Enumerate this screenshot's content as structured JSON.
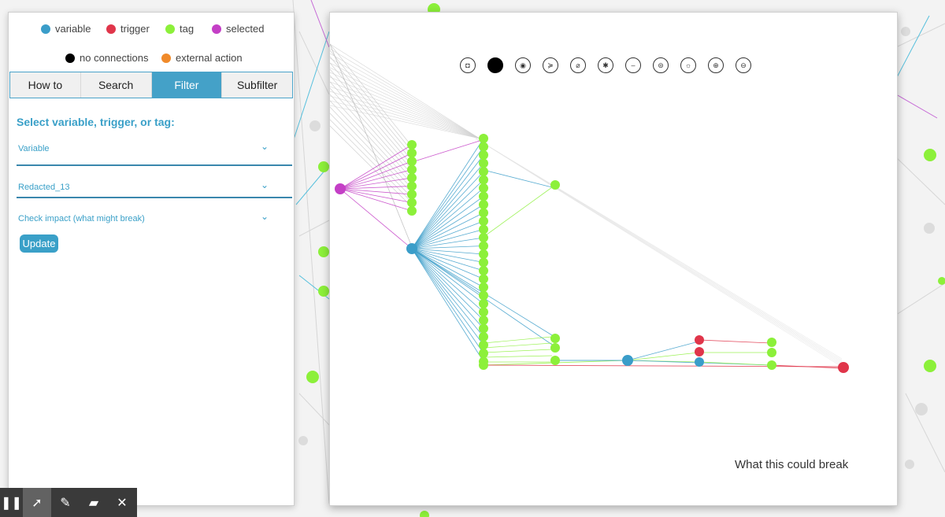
{
  "legend": {
    "items": [
      {
        "label": "variable",
        "color": "#3a9dc9"
      },
      {
        "label": "trigger",
        "color": "#e0354a"
      },
      {
        "label": "tag",
        "color": "#8cf03a"
      },
      {
        "label": "selected",
        "color": "#c43fc6"
      },
      {
        "label": "no connections",
        "color": "#000000"
      },
      {
        "label": "external action",
        "color": "#f08a2a"
      }
    ]
  },
  "tabs": [
    {
      "label": "How to",
      "active": false
    },
    {
      "label": "Search",
      "active": false
    },
    {
      "label": "Filter",
      "active": true
    },
    {
      "label": "Subfilter",
      "active": false
    }
  ],
  "filter": {
    "heading": "Select variable, trigger, or tag:",
    "type_select": "Variable",
    "item_select": "Redacted_13",
    "mode_select": "Check impact (what might break)",
    "update_label": "Update"
  },
  "graph": {
    "caption": "What this could break",
    "toolbar_icons": [
      "camera-icon",
      "filled-circle-icon",
      "target-icon",
      "bird-icon",
      "gauge-icon",
      "sparkle-icon",
      "minus-circle-icon",
      "equals-circle-icon",
      "sun-icon",
      "zoom-in-icon",
      "zoom-out-icon"
    ]
  },
  "strip": {
    "tools": [
      "pause-icon",
      "pointer-icon",
      "pen-icon",
      "eraser-icon",
      "close-icon"
    ]
  }
}
